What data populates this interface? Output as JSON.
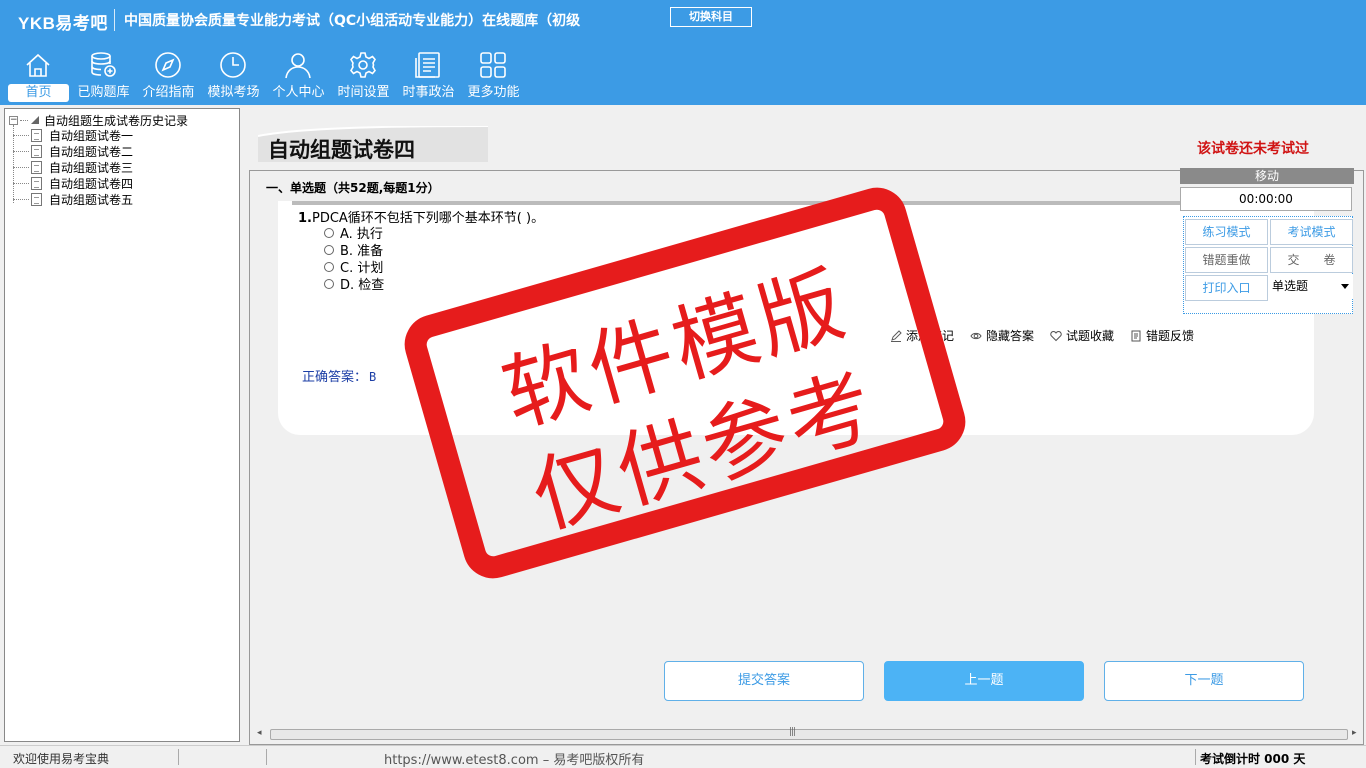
{
  "header": {
    "logo": "YKB易考吧",
    "title": "中国质量协会质量专业能力考试（QC小组活动专业能力）在线题库（初级",
    "switch_label": "切换科目",
    "nav": [
      {
        "label": "首页",
        "icon": "home-icon",
        "active": true
      },
      {
        "label": "已购题库",
        "icon": "database-icon"
      },
      {
        "label": "介绍指南",
        "icon": "compass-icon"
      },
      {
        "label": "模拟考场",
        "icon": "clock-icon"
      },
      {
        "label": "个人中心",
        "icon": "user-icon"
      },
      {
        "label": "时间设置",
        "icon": "gear-icon"
      },
      {
        "label": "时事政治",
        "icon": "news-icon"
      },
      {
        "label": "更多功能",
        "icon": "grid-icon"
      }
    ]
  },
  "sidebar": {
    "root": "自动组题生成试卷历史记录",
    "items": [
      "自动组题试卷一",
      "自动组题试卷二",
      "自动组题试卷三",
      "自动组题试卷四",
      "自动组题试卷五"
    ]
  },
  "main": {
    "paper_title": "自动组题试卷四",
    "status_note": "该试卷还未考试过",
    "section_head": "一、单选题（共52题,每题1分）",
    "question": {
      "number": "1.",
      "text": "PDCA循环不包括下列哪个基本环节( )。",
      "options": [
        "A. 执行",
        "B. 准备",
        "C. 计划",
        "D. 检查"
      ]
    },
    "tools": [
      "添加笔记",
      "隐藏答案",
      "试题收藏",
      "错题反馈"
    ],
    "answer_label": "正确答案：",
    "answer_value": "B",
    "buttons": {
      "submit": "提交答案",
      "prev": "上一题",
      "next": "下一题"
    }
  },
  "panel": {
    "move": "移动",
    "timer": "00:00:00",
    "practice": "练习模式",
    "exam": "考试模式",
    "redo": "错题重做",
    "hand_in": "交　　卷",
    "print": "打印入口",
    "type_select": "单选题"
  },
  "watermark": {
    "line1": "软件模版",
    "line2": "仅供参考"
  },
  "status_bar": {
    "welcome": "欢迎使用易考宝典",
    "copyright": "https://www.etest8.com – 易考吧版权所有",
    "countdown": "考试倒计时 000 天"
  },
  "colors": {
    "header": "#3c9be5",
    "stamp": "#e61c1c",
    "note": "#d01414",
    "answer": "#1d3fa6"
  }
}
